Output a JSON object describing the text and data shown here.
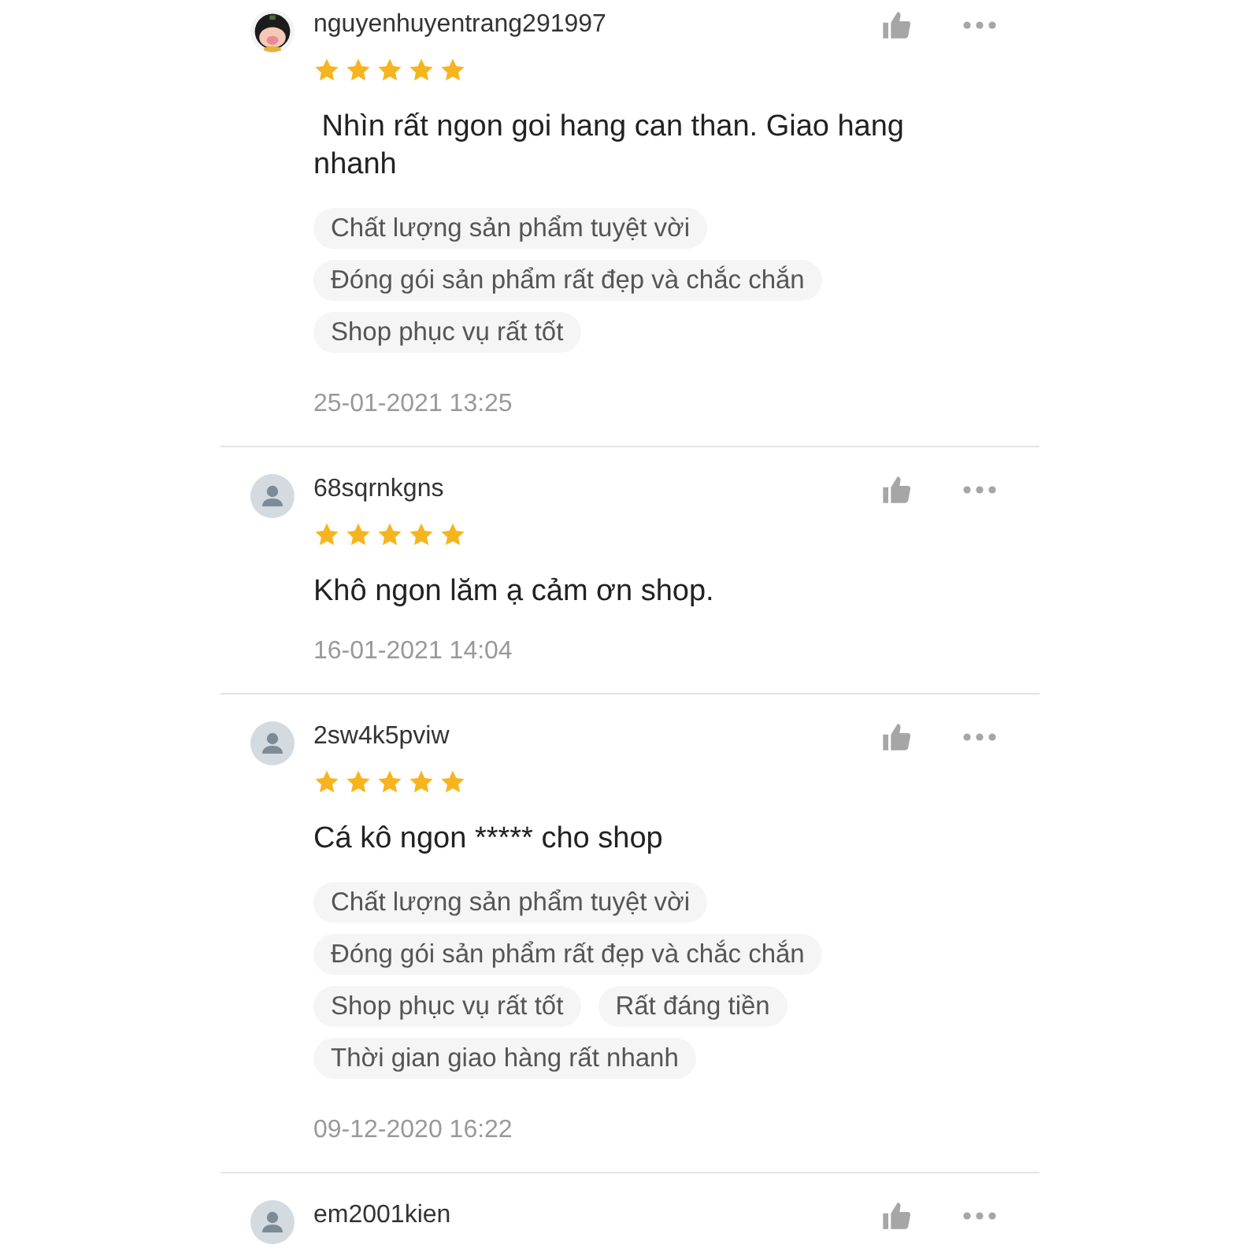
{
  "reviews": [
    {
      "avatar": {
        "kind": "picture"
      },
      "username": "nguyenhuyentrang291997",
      "stars": 5,
      "text": " Nhìn rất ngon goi hang can than. Giao hang nhanh",
      "tags": [
        "Chất lượng sản phẩm tuyệt vời",
        "Đóng gói sản phẩm rất đẹp và chắc chắn",
        "Shop phục vụ rất tốt"
      ],
      "date": "25-01-2021 13:25"
    },
    {
      "avatar": {
        "kind": "default"
      },
      "username": "68sqrnkgns",
      "stars": 5,
      "text": "Khô ngon lăm ạ cảm ơn shop.",
      "date": "16-01-2021 14:04"
    },
    {
      "avatar": {
        "kind": "default"
      },
      "username": "2sw4k5pviw",
      "stars": 5,
      "text": "Cá kô ngon ***** cho shop",
      "tags": [
        "Chất lượng sản phẩm tuyệt vời",
        "Đóng gói sản phẩm rất đẹp và chắc chắn",
        "Shop phục vụ rất tốt",
        "Rất đáng tiền",
        "Thời gian giao hàng rất nhanh"
      ],
      "date": "09-12-2020 16:22"
    },
    {
      "avatar": {
        "kind": "default"
      },
      "username": "em2001kien"
    }
  ]
}
